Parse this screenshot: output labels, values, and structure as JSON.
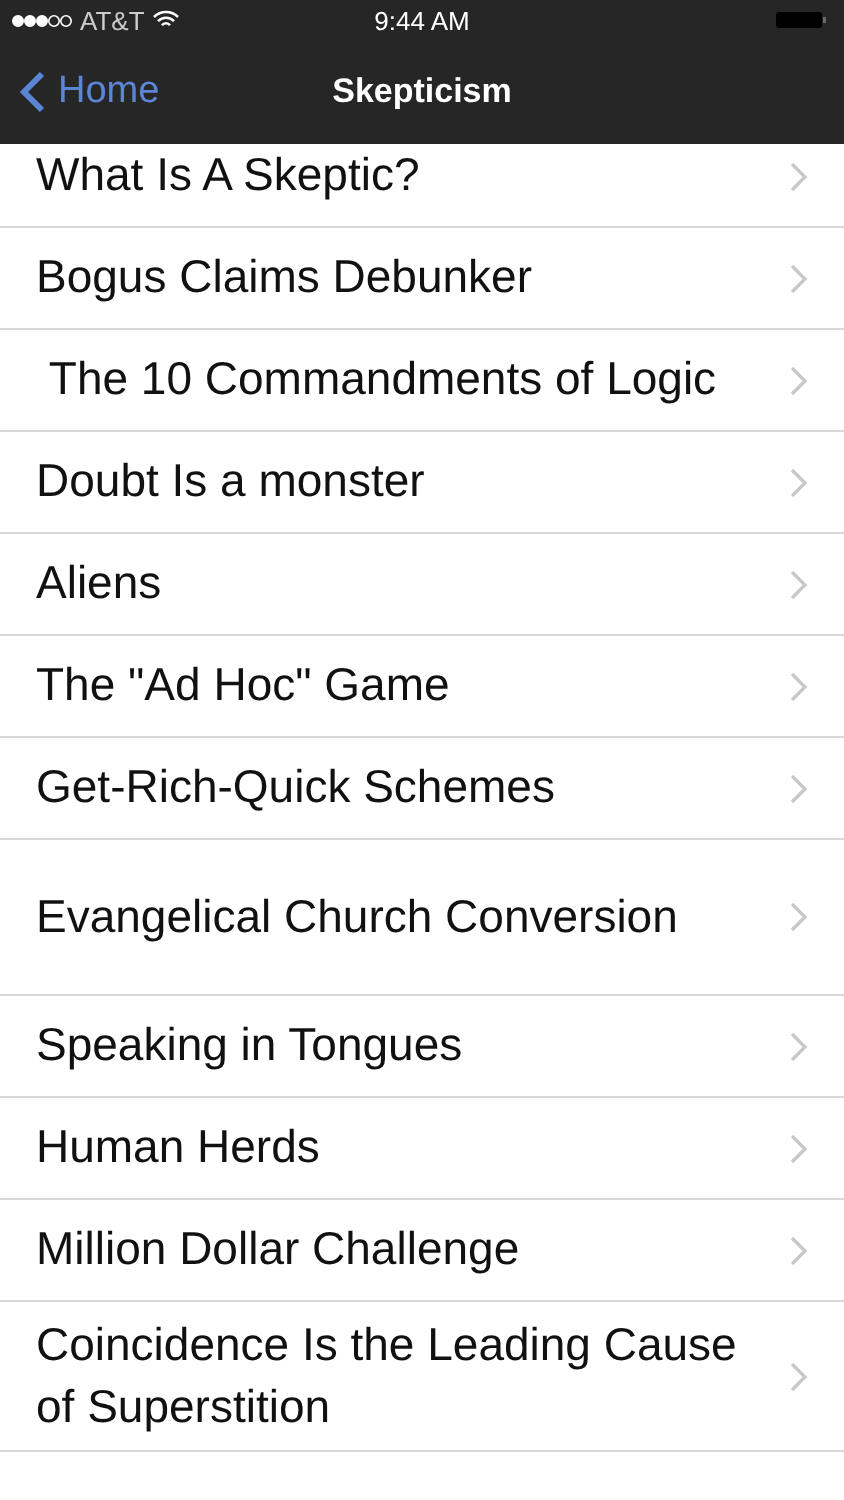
{
  "status_bar": {
    "carrier": "AT&T",
    "time": "9:44 AM"
  },
  "nav_bar": {
    "back": "Home",
    "title": "Skepticism"
  },
  "items": [
    {
      "label": "What Is A Skeptic?"
    },
    {
      "label": "Bogus Claims Debunker"
    },
    {
      "label": " The 10 Commandments of Logic"
    },
    {
      "label": "Doubt Is a monster"
    },
    {
      "label": "Aliens"
    },
    {
      "label": "The \"Ad Hoc\" Game"
    },
    {
      "label": "Get-Rich-Quick Schemes"
    },
    {
      "label": "Evangelical Church Conversion"
    },
    {
      "label": "Speaking in Tongues"
    },
    {
      "label": "Human Herds"
    },
    {
      "label": "Million Dollar Challenge"
    },
    {
      "label": "Coincidence Is the Leading Cause of Superstition"
    }
  ]
}
